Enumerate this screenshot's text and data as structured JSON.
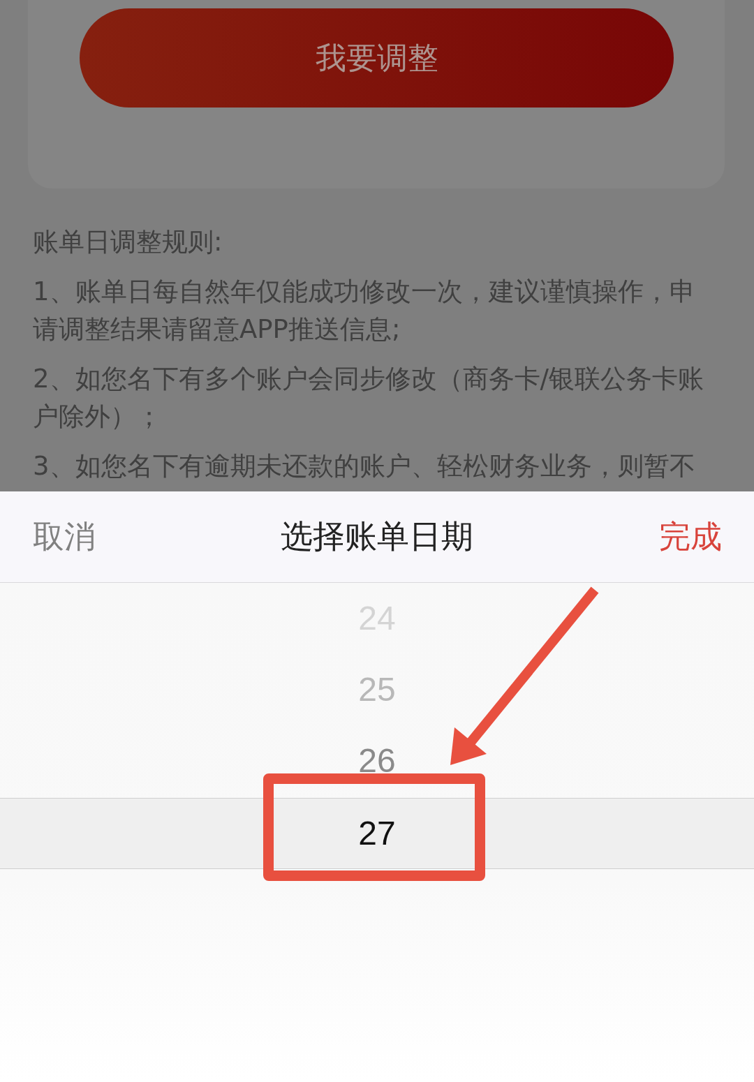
{
  "background_page": {
    "adjust_button": "我要调整",
    "rules": {
      "title": "账单日调整规则:",
      "items": [
        "1、账单日每自然年仅能成功修改一次，建议谨慎操作，申请调整结果请留意APP推送信息;",
        "2、如您名下有多个账户会同步修改（商务卡/银联公务卡账户除外）；",
        "3、如您名下有逾期未还款的账户、轻松财务业务，则暂不"
      ]
    }
  },
  "date_sheet": {
    "cancel": "取消",
    "title": "选择账单日期",
    "done": "完成",
    "items": [
      {
        "label": "24",
        "selected": false
      },
      {
        "label": "25",
        "selected": false
      },
      {
        "label": "26",
        "selected": false
      },
      {
        "label": "27",
        "selected": true
      }
    ]
  },
  "annotation": {
    "highlight_frame": true,
    "pointer_arrow": true
  }
}
